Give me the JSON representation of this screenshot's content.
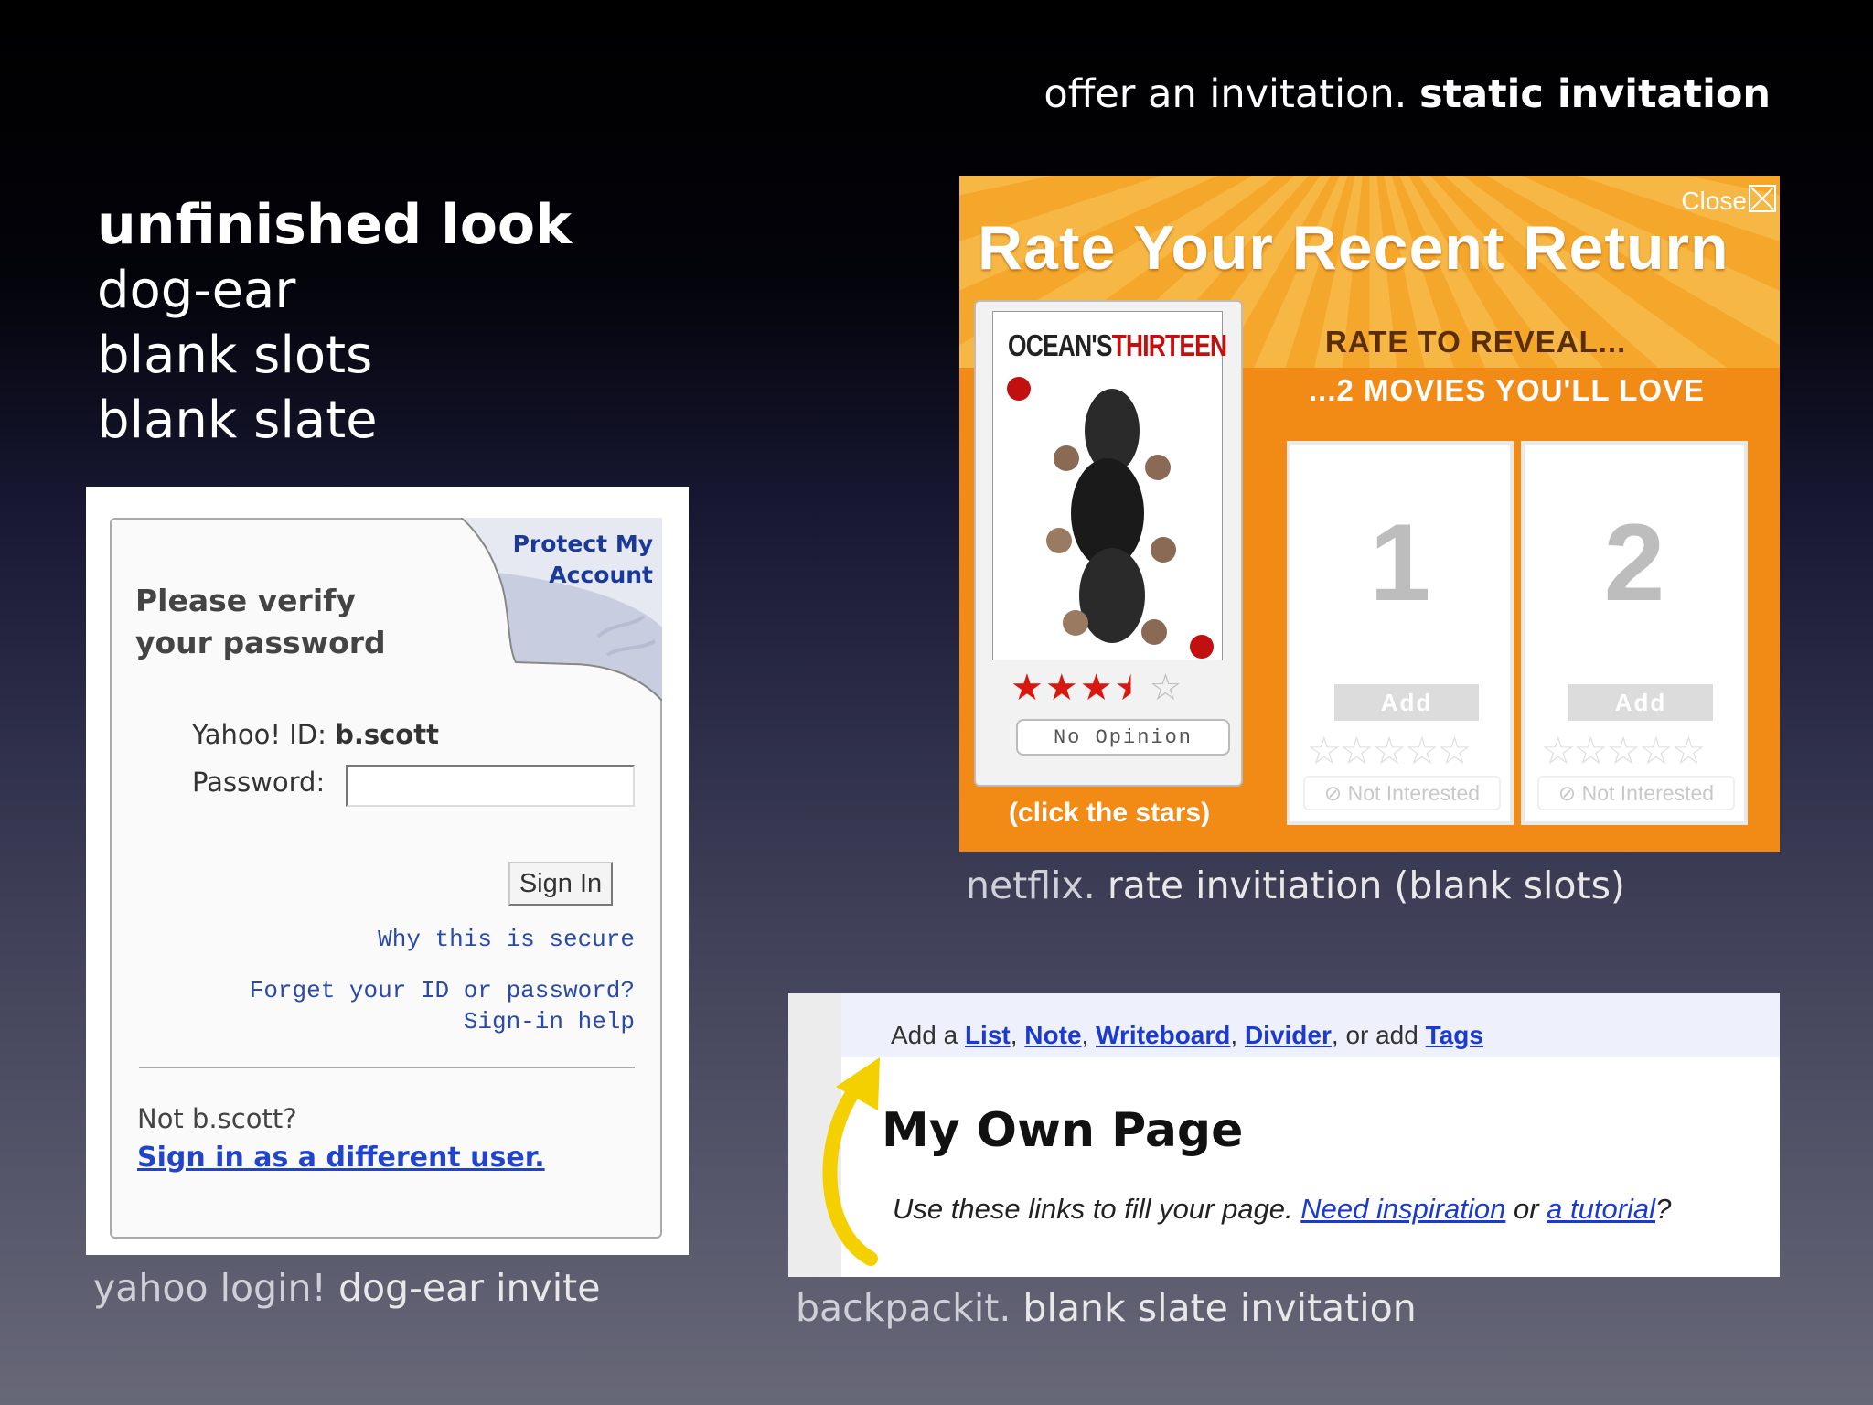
{
  "header": {
    "light": "offer an invitation.",
    "bold": "static invitation"
  },
  "left_title": {
    "heading": "unfinished look",
    "lines": [
      "dog-ear",
      "blank slots",
      "blank slate"
    ]
  },
  "yahoo": {
    "protect_line1": "Protect My",
    "protect_line2": "Account",
    "verify_line1": "Please verify",
    "verify_line2": "your password",
    "id_label": "Yahoo! ID:",
    "id_value": "b.scott",
    "password_label": "Password:",
    "password_value": "",
    "signin_label": "Sign In",
    "why_secure": "Why this is secure",
    "forgot": "Forget your ID or password?",
    "help": "Sign-in help",
    "not_user": "Not b.scott?",
    "different_user": "Sign in as a different user."
  },
  "yahoo_caption": {
    "light": "yahoo login!",
    "bold": "dog-ear invite"
  },
  "netflix": {
    "close_label": "Close",
    "title": "Rate Your Recent Return",
    "poster_title_a": "OCEAN'S",
    "poster_title_b": "THIRTEEN",
    "rating": 3.5,
    "rating_max": 5,
    "no_opinion": "No Opinion",
    "click_stars": "(click the stars)",
    "rate_reveal": "RATE TO REVEAL...",
    "two_movies": "...2 MOVIES YOU'LL LOVE",
    "slots": [
      {
        "number": "1",
        "add_label": "Add",
        "not_interested": "Not Interested"
      },
      {
        "number": "2",
        "add_label": "Add",
        "not_interested": "Not Interested"
      }
    ],
    "colors": {
      "orange": "#f28a16",
      "star_red": "#d8180f"
    }
  },
  "netflix_caption": {
    "light": "netflix.",
    "bold": "rate invitiation (blank slots)"
  },
  "backpack": {
    "add_a": "Add a",
    "links": [
      "List",
      "Note",
      "Writeboard",
      "Divider"
    ],
    "or_add": "or add",
    "tags": "Tags",
    "title": "My Own Page",
    "hint": "Use these links to fill your page.",
    "need_inspiration": "Need inspiration",
    "or": "or",
    "tutorial": "a tutorial",
    "end": "?",
    "arrow_color": "#f5d000"
  },
  "backpack_caption": {
    "light": "backpackit.",
    "bold": "blank slate invitation"
  }
}
